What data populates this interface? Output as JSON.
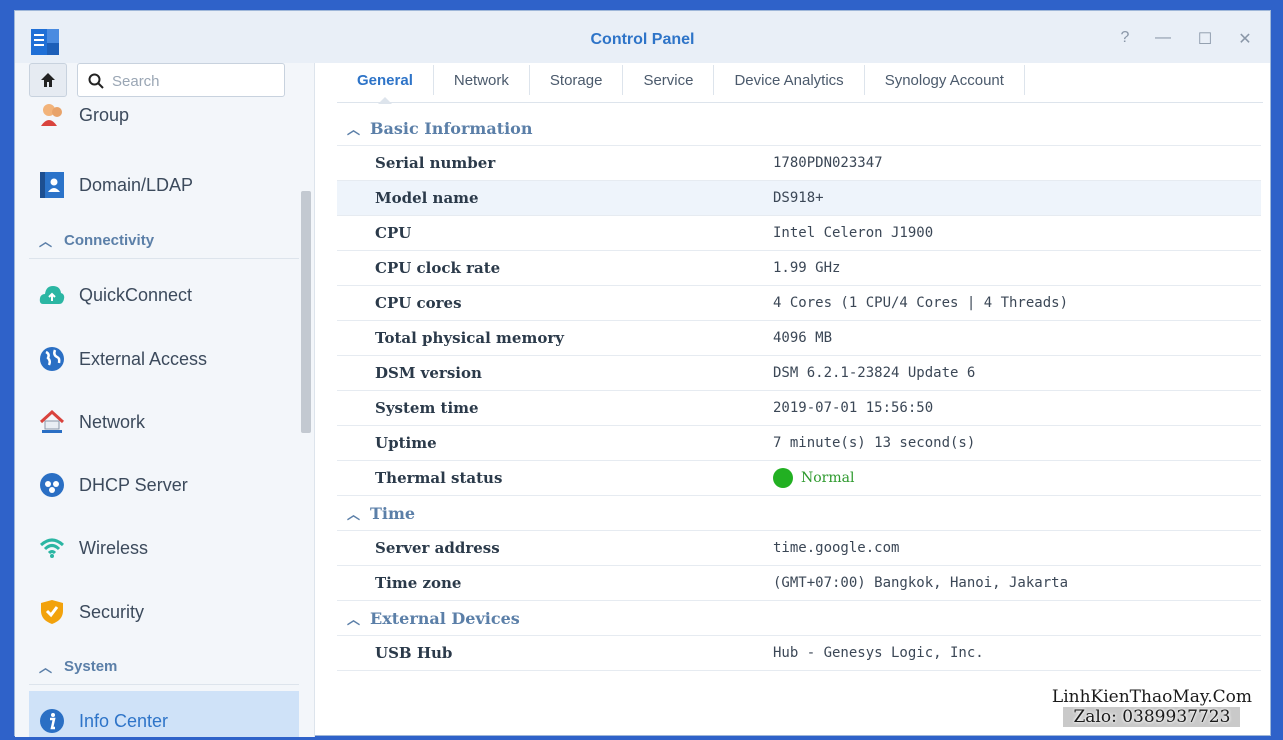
{
  "window": {
    "title": "Control Panel",
    "controls": [
      "?",
      "—",
      "☐",
      "✕"
    ]
  },
  "sidebar": {
    "search_placeholder": "Search",
    "items": [
      {
        "label": "Group",
        "icon": "group-icon"
      },
      {
        "label": "Domain/LDAP",
        "icon": "domain-ldap-icon"
      },
      {
        "label": "Connectivity",
        "header": true
      },
      {
        "label": "QuickConnect",
        "icon": "quickconnect-icon"
      },
      {
        "label": "External Access",
        "icon": "globe-icon"
      },
      {
        "label": "Network",
        "icon": "network-house-icon"
      },
      {
        "label": "DHCP Server",
        "icon": "dhcp-server-icon"
      },
      {
        "label": "Wireless",
        "icon": "wifi-icon"
      },
      {
        "label": "Security",
        "icon": "shield-icon"
      },
      {
        "label": "System",
        "header": true
      },
      {
        "label": "Info Center",
        "icon": "info-icon",
        "active": true
      }
    ]
  },
  "tabs": [
    "General",
    "Network",
    "Storage",
    "Service",
    "Device Analytics",
    "Synology Account"
  ],
  "active_tab": "General",
  "sections": {
    "basic": {
      "title": "Basic Information",
      "rows": [
        {
          "key": "Serial number",
          "value": "1780PDN023347"
        },
        {
          "key": "Model name",
          "value": "DS918+"
        },
        {
          "key": "CPU",
          "value": "Intel Celeron J1900"
        },
        {
          "key": "CPU clock rate",
          "value": "1.99 GHz"
        },
        {
          "key": "CPU cores",
          "value": "4 Cores (1 CPU/4 Cores | 4 Threads)"
        },
        {
          "key": "Total physical memory",
          "value": "4096 MB"
        },
        {
          "key": "DSM version",
          "value": "DSM 6.2.1-23824 Update 6"
        },
        {
          "key": "System time",
          "value": "2019-07-01 15:56:50"
        },
        {
          "key": "Uptime",
          "value": "7 minute(s) 13 second(s)"
        },
        {
          "key": "Thermal status",
          "value": "Normal"
        }
      ]
    },
    "time": {
      "title": "Time",
      "rows": [
        {
          "key": "Server address",
          "value": "time.google.com"
        },
        {
          "key": "Time zone",
          "value": "(GMT+07:00) Bangkok, Hanoi, Jakarta"
        }
      ]
    },
    "external": {
      "title": "External Devices",
      "rows": [
        {
          "key": "USB Hub",
          "value": "Hub - Genesys Logic, Inc."
        }
      ]
    }
  },
  "colors": {
    "accent": "#2e74c8",
    "section_header": "#5b7fa8",
    "status_ok": "#22b022",
    "active_bg": "#cfe2f8"
  },
  "watermark": {
    "line1": "LinhKienThaoMay.Com",
    "line2": "Zalo: 0389937723"
  }
}
